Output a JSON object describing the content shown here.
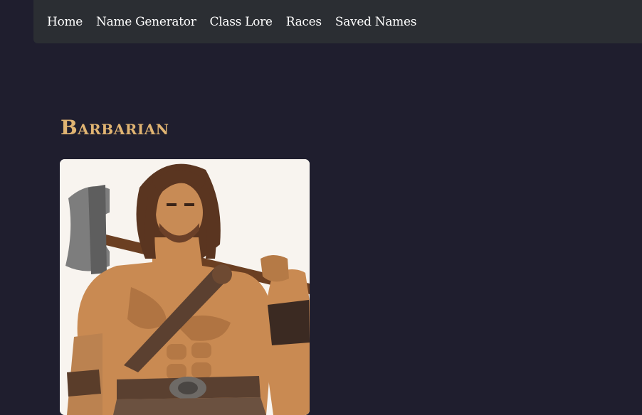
{
  "nav": {
    "items": [
      {
        "label": "Home"
      },
      {
        "label": "Name Generator"
      },
      {
        "label": "Class Lore"
      },
      {
        "label": "Races"
      },
      {
        "label": "Saved Names"
      }
    ]
  },
  "main": {
    "title": "Barbarian",
    "image_subject": "barbarian-with-axe"
  },
  "colors": {
    "background": "#1f1e2e",
    "navbar": "#2b2e33",
    "title": "#e0b472",
    "nav_text": "#ffffff"
  }
}
